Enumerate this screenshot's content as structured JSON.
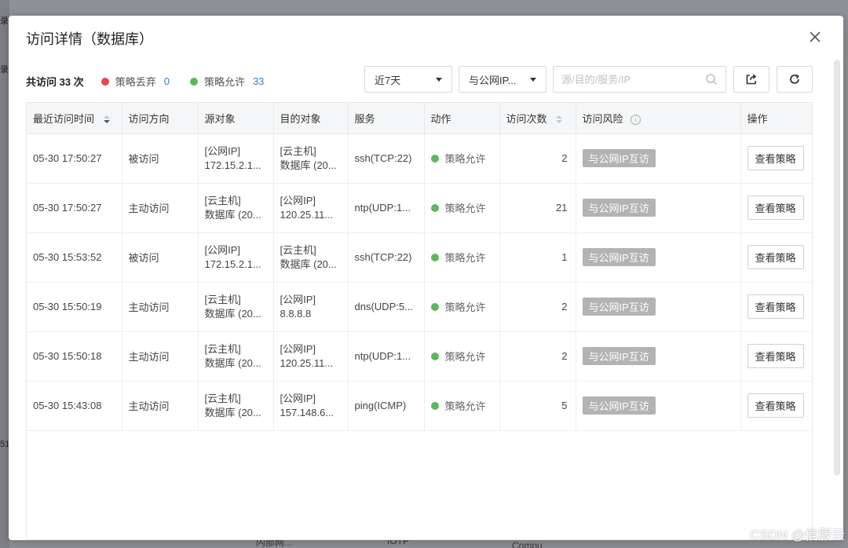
{
  "background": {
    "fragment_1": "内部网...",
    "fragment_2": "IOTP",
    "fragment_3": "Compu",
    "left_1": "录",
    "left_2": "录",
    "left_3": "51"
  },
  "dialog": {
    "title": "访问详情（数据库）",
    "close_icon": "close-icon"
  },
  "stats": {
    "total": "共访问 33 次",
    "dropped_label": "策略丢弃",
    "dropped_count": "0",
    "dropped_color": "#e04a4a",
    "allowed_label": "策略允许",
    "allowed_count": "33",
    "allowed_color": "#5cb85c"
  },
  "filters": {
    "time_range": "近7天",
    "ip_filter": "与公网IP...",
    "search_placeholder": "源/目的/服务/IP"
  },
  "table": {
    "headers": [
      "最近访问时间",
      "访问方向",
      "源对象",
      "目的对象",
      "服务",
      "动作",
      "访问次数",
      "访问风险",
      "操作"
    ],
    "rows": [
      {
        "time": "05-30 17:50:27",
        "direction": "被访问",
        "src_1": "[公网IP]",
        "src_2": "172.15.2.1...",
        "dst_1": "[云主机]",
        "dst_2": "数据库 (20...",
        "service": "ssh(TCP:22)",
        "action": "策略允许",
        "count": "2",
        "risk": "与公网IP互访",
        "op": "查看策略"
      },
      {
        "time": "05-30 17:50:27",
        "direction": "主动访问",
        "src_1": "[云主机]",
        "src_2": "数据库 (20...",
        "dst_1": "[公网IP]",
        "dst_2": "120.25.11...",
        "service": "ntp(UDP:1...",
        "action": "策略允许",
        "count": "21",
        "risk": "与公网IP互访",
        "op": "查看策略"
      },
      {
        "time": "05-30 15:53:52",
        "direction": "被访问",
        "src_1": "[公网IP]",
        "src_2": "172.15.2.1...",
        "dst_1": "[云主机]",
        "dst_2": "数据库 (20...",
        "service": "ssh(TCP:22)",
        "action": "策略允许",
        "count": "1",
        "risk": "与公网IP互访",
        "op": "查看策略"
      },
      {
        "time": "05-30 15:50:19",
        "direction": "主动访问",
        "src_1": "[云主机]",
        "src_2": "数据库 (20...",
        "dst_1": "[公网IP]",
        "dst_2": "8.8.8.8",
        "service": "dns(UDP:5...",
        "action": "策略允许",
        "count": "2",
        "risk": "与公网IP互访",
        "op": "查看策略"
      },
      {
        "time": "05-30 15:50:18",
        "direction": "主动访问",
        "src_1": "[云主机]",
        "src_2": "数据库 (20...",
        "dst_1": "[公网IP]",
        "dst_2": "120.25.11...",
        "service": "ntp(UDP:1...",
        "action": "策略允许",
        "count": "2",
        "risk": "与公网IP互访",
        "op": "查看策略"
      },
      {
        "time": "05-30 15:43:08",
        "direction": "主动访问",
        "src_1": "[云主机]",
        "src_2": "数据库 (20...",
        "dst_1": "[公网IP]",
        "dst_2": "157.148.6...",
        "service": "ping(ICMP)",
        "action": "策略允许",
        "count": "5",
        "risk": "与公网IP互访",
        "op": "查看策略"
      }
    ]
  },
  "watermark": "CSDN @信服云"
}
